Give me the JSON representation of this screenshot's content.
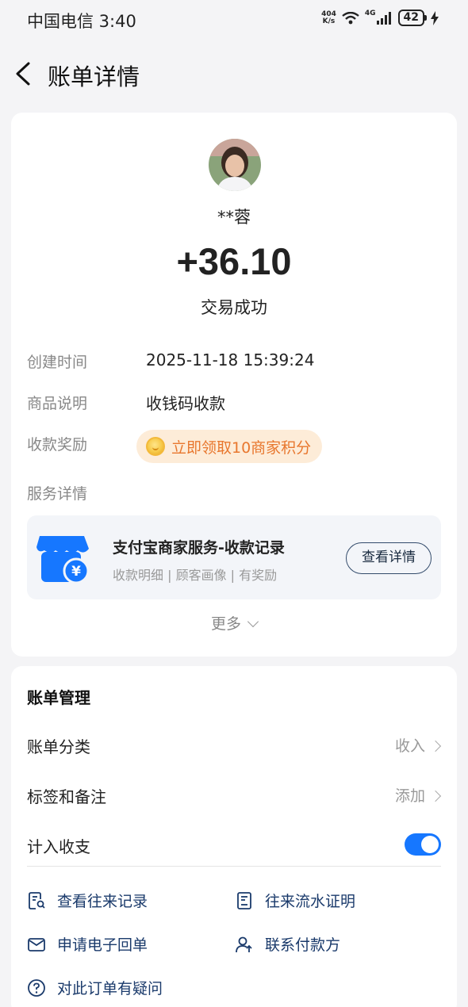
{
  "status_bar": {
    "carrier_time": "中国电信 3:40",
    "speed_value": "404",
    "speed_unit": "K/s",
    "network": "4G",
    "battery": "42",
    "icons": [
      "wifi-icon",
      "signal-icon",
      "charging-icon"
    ]
  },
  "header": {
    "title": "账单详情",
    "back_icon": "chevron-left-icon"
  },
  "transaction": {
    "name": "**蓉",
    "amount": "+36.10",
    "status": "交易成功"
  },
  "details": {
    "created_label": "创建时间",
    "created_value": "2025-11-18 15:39:24",
    "product_label": "商品说明",
    "product_value": "收钱码收款",
    "reward_label": "收款奖励",
    "reward_value": "立即领取10商家积分",
    "service_label": "服务详情"
  },
  "service": {
    "title": "支付宝商家服务-收款记录",
    "subtitle": "收款明细 | 顾客画像 | 有奖励",
    "button": "查看详情"
  },
  "more_label": "更多",
  "management": {
    "title": "账单管理",
    "category_label": "账单分类",
    "category_value": "收入",
    "tags_label": "标签和备注",
    "tags_value": "添加",
    "include_label": "计入收支",
    "include_on": true
  },
  "links": {
    "history": "查看往来记录",
    "statement": "往来流水证明",
    "receipt": "申请电子回单",
    "contact": "联系付款方",
    "question": "对此订单有疑问"
  },
  "colors": {
    "accent": "#1677ff",
    "reward": "#e8772e",
    "link": "#1a3a6b",
    "background": "#f4f4f6"
  }
}
